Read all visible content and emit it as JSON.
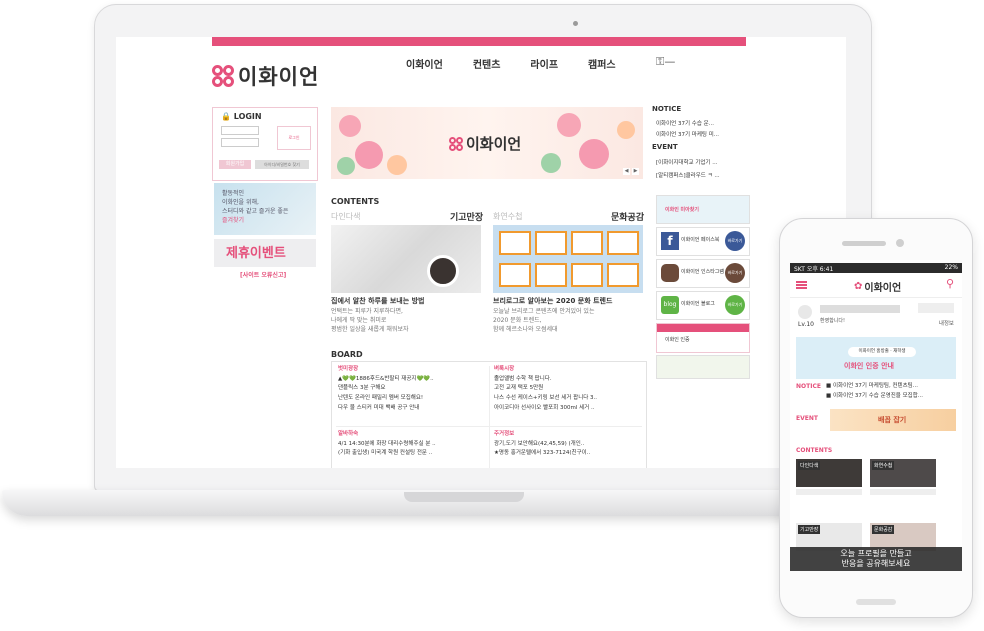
{
  "site": {
    "logo_text": "이화이언",
    "nav": [
      "이화이언",
      "컨텐츠",
      "라이프",
      "캠퍼스"
    ]
  },
  "login": {
    "title": "LOGIN",
    "login_button": "로그인",
    "join_button": "회원가입",
    "find_button": "아이디/비밀번호 찾기"
  },
  "side": {
    "banner1_lines": [
      "활동적인",
      "이화인을 위해,",
      "스터디와 같고 즐거운 좋은",
      "즐겨찾기"
    ],
    "banner2_title": "제휴이벤트",
    "banner2_caption": "[사이트 오류신고]"
  },
  "hero": {
    "logo_text": "이화이언"
  },
  "contents": {
    "title": "CONTENTS",
    "col1_head": "다인다색",
    "col1_right": "기고만장",
    "col2_head": "화연수첩",
    "col2_right": "문화공감",
    "card1_title": "집에서 알찬 하루를 보내는 방법",
    "card1_desc": [
      "언택트는 피루가 지루하다면,",
      "나에게 딱 맞는 취미로",
      "평범한 일상을 새롭게 채워보자"
    ],
    "card2_title": "브리로그로 알아보는 2020 문화 트렌드",
    "card2_desc": [
      "오늘날 브리로그 콘텐츠에 안겨있어 있는",
      "2020 문화 트렌드,",
      "함께 헤르소나와 오썸세대"
    ]
  },
  "board": {
    "title": "BOARD",
    "sections": [
      {
        "head": "벗미광장",
        "items": [
          "▲💚💚1886후드&반팔티 재공지💚💚..",
          "댄플릭스 3분 구해요",
          "난텐도 온라인 패밀리 멤버 모집해요!",
          "다우 물 스티커 미대 백배 공구 안내"
        ]
      },
      {
        "head": "벼룩시장",
        "items": [
          "졸업앨범 수학 책 팝니다.",
          "고전 교재 택포 5만원",
          "나스 수선 케이스+키링 보선 세거 팝니다 3..",
          "아이코디아 선사이오 빨포회 300ml 세거 .."
        ]
      },
      {
        "head": "알바하숙",
        "items": [
          "4/1 14:30분에 화장 대리수령해주실 분 ..",
          "(기화 출입생) 미국계 학원 컨설팅 전문 .."
        ]
      },
      {
        "head": "주거정보",
        "items": [
          "광기,도기 보안해요(42,45,59) (개인..",
          "★명동 홍거운텔에서 323-7124(친구이.."
        ]
      }
    ]
  },
  "notice": {
    "title": "NOTICE",
    "items": [
      "이화이언 37기 수습 운...",
      "이화이언 37기 마케팅 미..."
    ]
  },
  "event": {
    "title": "EVENT",
    "items": [
      "[이화이지대학교 기업기 ...",
      "[알티캠퍼스]클라우드 ㅋ ..."
    ]
  },
  "sns": [
    {
      "label": "이화이언 페이스북",
      "circle": "바로가기",
      "color": "#3b5998"
    },
    {
      "label": "이화이언 인스타그램",
      "circle": "바로가기",
      "color": "#6b4a3a"
    },
    {
      "label": "이화이언 블로그",
      "circle": "바로가기",
      "color": "#5fb446"
    }
  ],
  "side_small": {
    "banner_title": "이화인 미아찾기",
    "banner_caption": "이화인 인증"
  },
  "phone": {
    "status_left": "SKT 오후 6:41",
    "status_right": "22%",
    "logo_text": "이화이언",
    "level": "Lv.10",
    "welcome": "환영합니다!",
    "logout": "내정보",
    "banner_chip": "이화이언 홈방출 · 재학생",
    "banner_big": "이화인 인증 안내",
    "notice_title": "NOTICE",
    "notice_items": [
      "■ 이화이언 37기 마케팅팀, 컨텐츠팀...",
      "■ 이화이언 37기 수습 운영진을 모집합..."
    ],
    "event_title": "EVENT",
    "event_banner": "배꼽 잡기",
    "contents_title": "CONTENTS",
    "tiles": [
      "다인다색",
      "화연수첩",
      "기고만장",
      "문화공감"
    ],
    "toast": [
      "오늘 프로필을 만들고",
      "반응을 공유해보세요"
    ]
  }
}
